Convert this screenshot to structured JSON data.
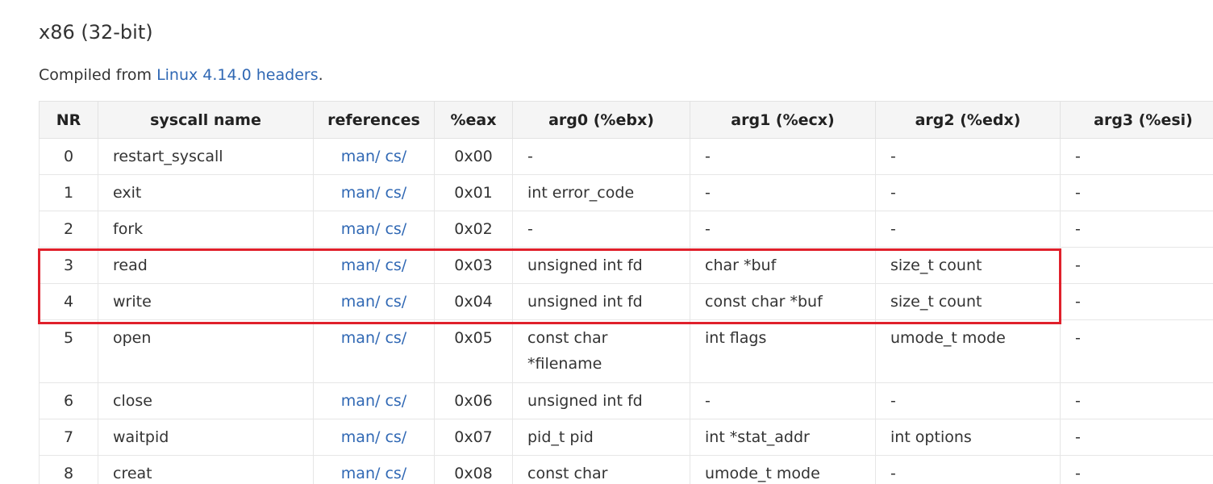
{
  "section": {
    "title": "x86 (32-bit)",
    "intro_prefix": "Compiled from ",
    "intro_link": "Linux 4.14.0 headers",
    "intro_suffix": "."
  },
  "table": {
    "headers": [
      "NR",
      "syscall name",
      "references",
      "%eax",
      "arg0 (%ebx)",
      "arg1 (%ecx)",
      "arg2 (%edx)",
      "arg3 (%esi)"
    ],
    "ref_labels": {
      "man": "man/",
      "cs": "cs/"
    },
    "rows": [
      {
        "nr": "0",
        "name": "restart_syscall",
        "eax": "0x00",
        "arg0": "-",
        "arg1": "-",
        "arg2": "-",
        "arg3": "-"
      },
      {
        "nr": "1",
        "name": "exit",
        "eax": "0x01",
        "arg0": "int error_code",
        "arg1": "-",
        "arg2": "-",
        "arg3": "-"
      },
      {
        "nr": "2",
        "name": "fork",
        "eax": "0x02",
        "arg0": "-",
        "arg1": "-",
        "arg2": "-",
        "arg3": "-"
      },
      {
        "nr": "3",
        "name": "read",
        "eax": "0x03",
        "arg0": "unsigned int fd",
        "arg1": "char *buf",
        "arg2": "size_t count",
        "arg3": "-"
      },
      {
        "nr": "4",
        "name": "write",
        "eax": "0x04",
        "arg0": "unsigned int fd",
        "arg1": "const char *buf",
        "arg2": "size_t count",
        "arg3": "-"
      },
      {
        "nr": "5",
        "name": "open",
        "eax": "0x05",
        "arg0": "const char *filename",
        "arg1": "int flags",
        "arg2": "umode_t mode",
        "arg3": "-"
      },
      {
        "nr": "6",
        "name": "close",
        "eax": "0x06",
        "arg0": "unsigned int fd",
        "arg1": "-",
        "arg2": "-",
        "arg3": "-"
      },
      {
        "nr": "7",
        "name": "waitpid",
        "eax": "0x07",
        "arg0": "pid_t pid",
        "arg1": "int *stat_addr",
        "arg2": "int options",
        "arg3": "-"
      },
      {
        "nr": "8",
        "name": "creat",
        "eax": "0x08",
        "arg0": "const char",
        "arg1": "umode_t mode",
        "arg2": "-",
        "arg3": "-"
      }
    ]
  },
  "colors": {
    "link": "#3068b4",
    "header_bg": "#f5f5f5",
    "highlight_border": "#e0202b"
  }
}
